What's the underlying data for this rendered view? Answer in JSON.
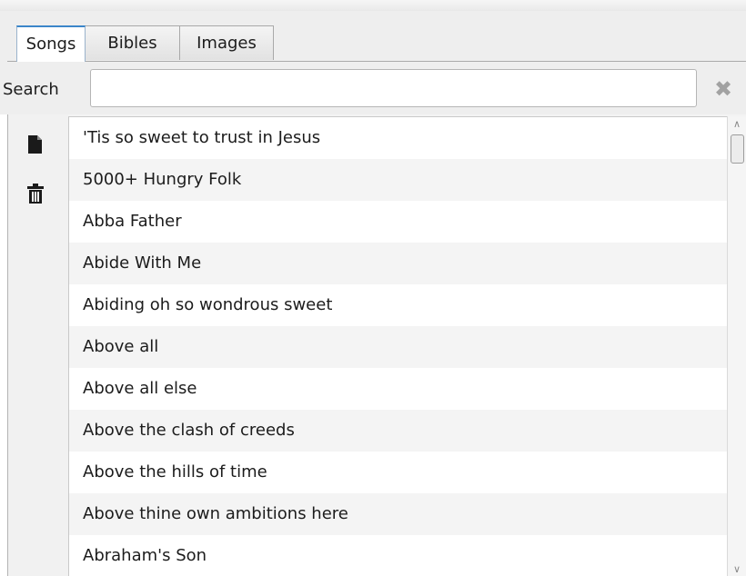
{
  "tabs": [
    {
      "label": "Songs",
      "active": true
    },
    {
      "label": "Bibles",
      "active": false
    },
    {
      "label": "Images",
      "active": false
    }
  ],
  "search": {
    "label": "Search",
    "value": "",
    "clear_icon": "✖"
  },
  "toolbar": {
    "new_icon": "document-icon",
    "delete_icon": "trash-icon"
  },
  "songs": [
    "'Tis so sweet to trust in Jesus",
    "5000+ Hungry Folk",
    "Abba Father",
    "Abide With Me",
    "Abiding oh so wondrous sweet",
    "Above all",
    "Above all else",
    "Above the clash of creeds",
    "Above the hills of time",
    "Above thine own ambitions here",
    "Abraham's Son"
  ],
  "colors": {
    "active_tab_accent": "#3b86c9",
    "row_alt": "#f4f4f4"
  }
}
